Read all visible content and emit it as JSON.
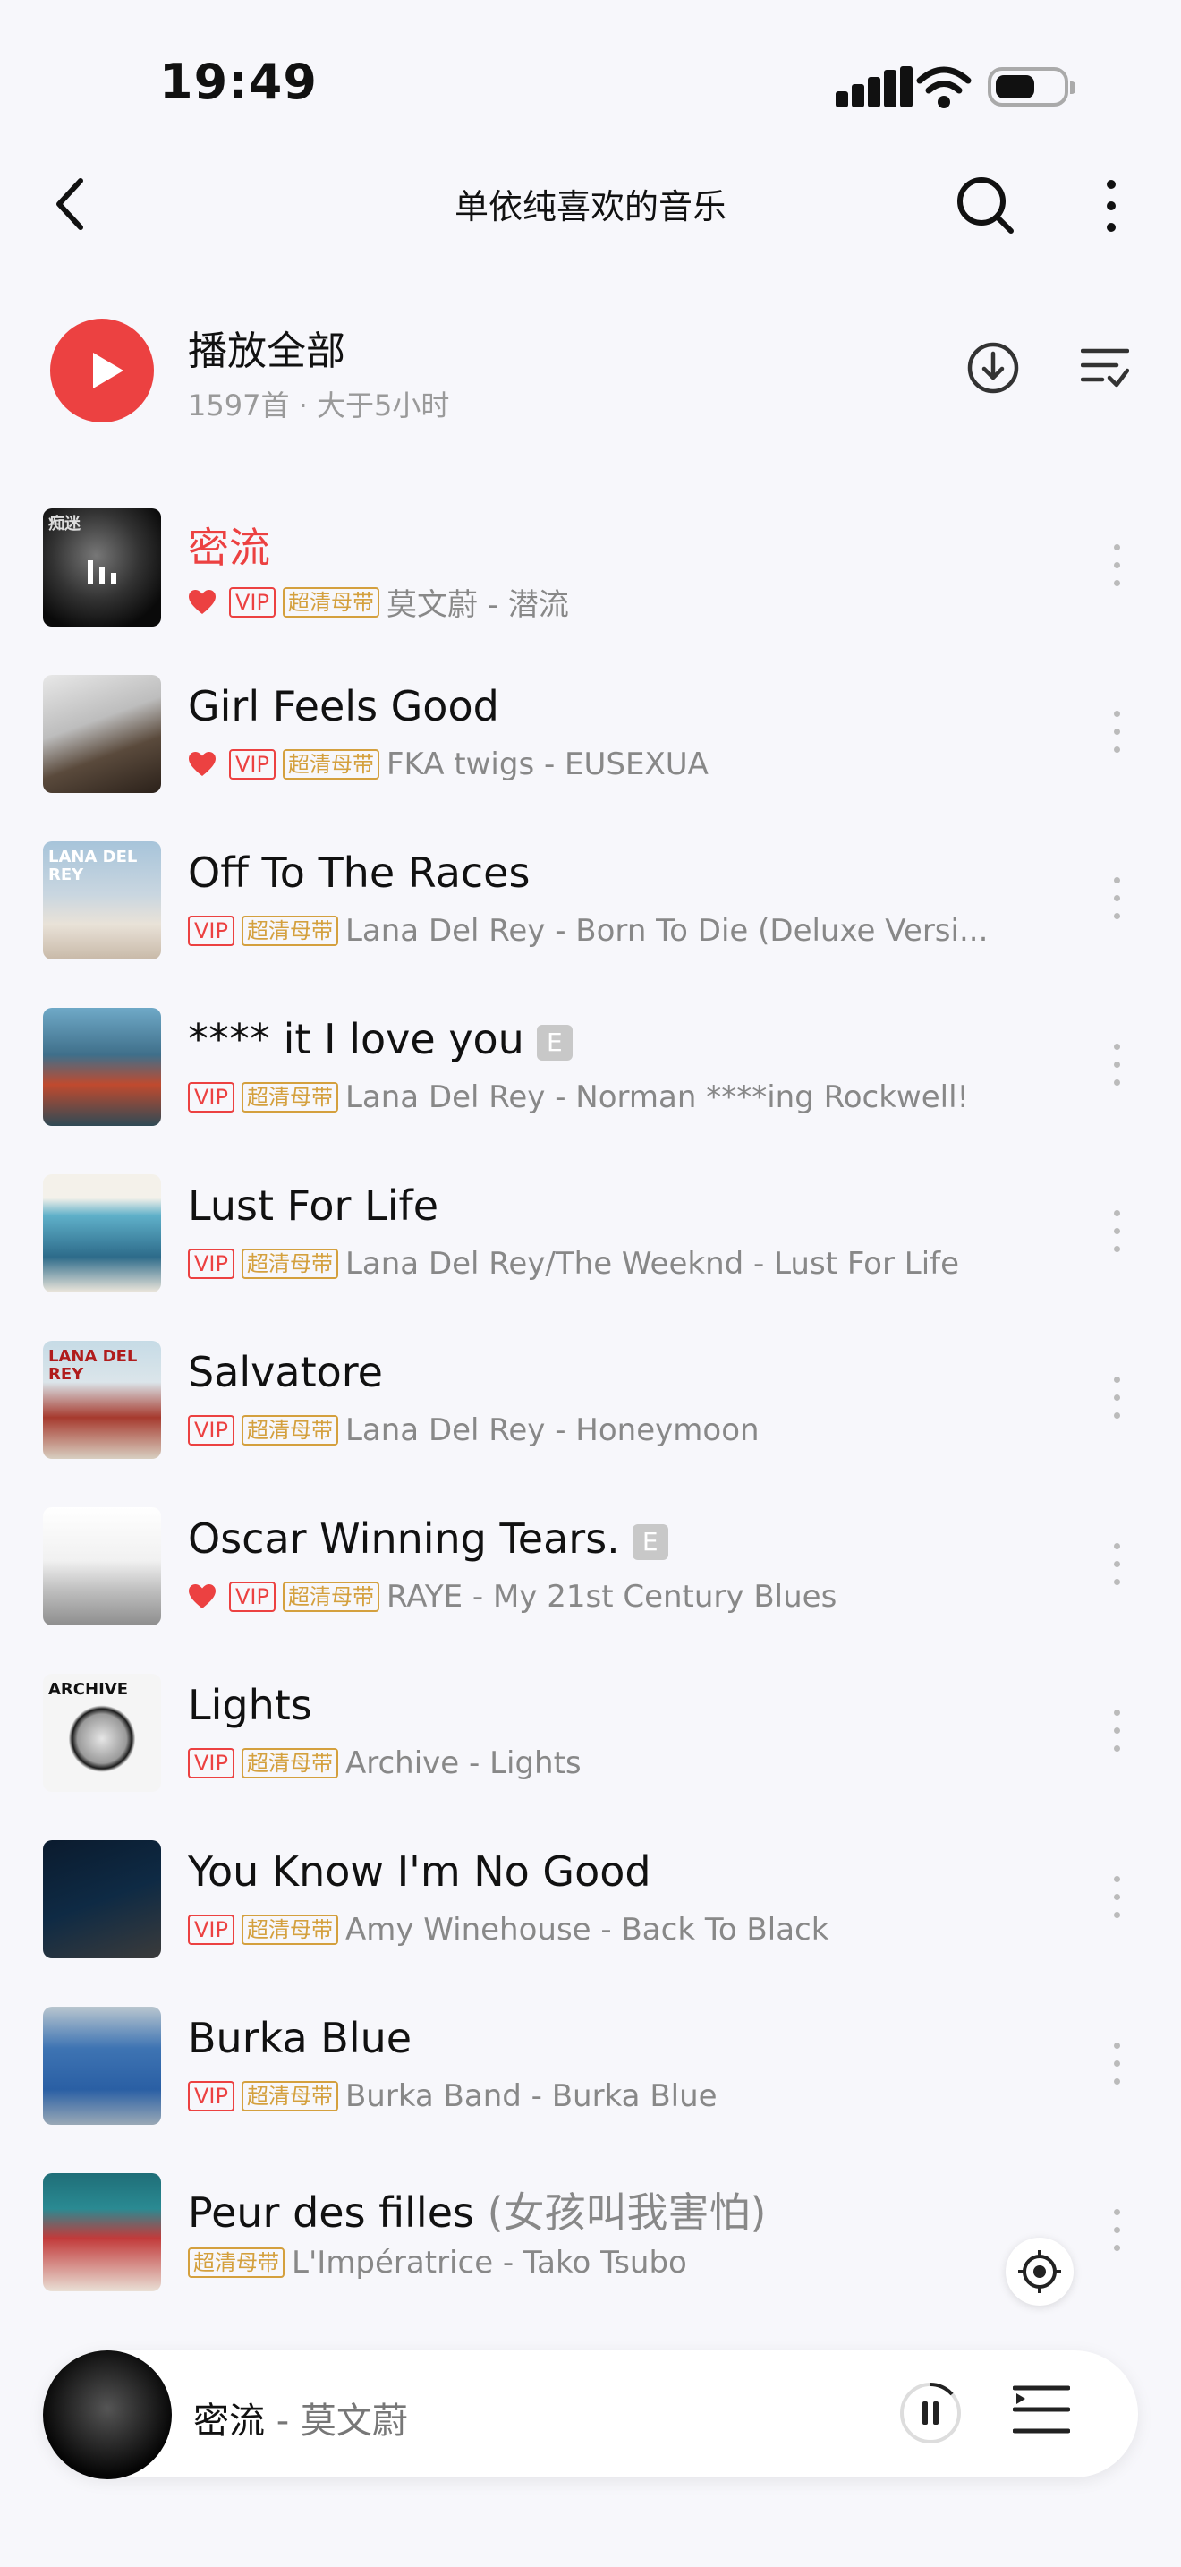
{
  "status": {
    "time": "19:49"
  },
  "nav": {
    "title": "单依纯喜欢的音乐"
  },
  "play_all": {
    "label": "播放全部",
    "count": "1597首 · 大于5小时"
  },
  "badges": {
    "vip": "VIP",
    "hq": "超清母带",
    "explicit": "E"
  },
  "covers": {
    "c0": "痴迷",
    "c2": "LANA DEL REY",
    "c5": "LANA DEL REY",
    "c7": "ARCHIVE"
  },
  "songs": [
    {
      "title": "密流",
      "meta": "莫文蔚 - 潜流",
      "playing": true,
      "liked": true,
      "vip": true,
      "hq": true,
      "explicit": false
    },
    {
      "title": "Girl Feels Good",
      "meta": "FKA twigs - EUSEXUA",
      "liked": true,
      "vip": true,
      "hq": true,
      "explicit": false
    },
    {
      "title": "Off To The Races",
      "meta": "Lana Del Rey - Born To Die (Deluxe Versi...",
      "liked": false,
      "vip": true,
      "hq": true,
      "explicit": false
    },
    {
      "title": "**** it I love you",
      "meta": "Lana Del Rey - Norman ****ing Rockwell!",
      "liked": false,
      "vip": true,
      "hq": true,
      "explicit": true
    },
    {
      "title": "Lust For Life",
      "meta": "Lana Del Rey/The Weeknd - Lust For Life",
      "liked": false,
      "vip": true,
      "hq": true,
      "explicit": false
    },
    {
      "title": "Salvatore",
      "meta": "Lana Del Rey - Honeymoon",
      "liked": false,
      "vip": true,
      "hq": true,
      "explicit": false
    },
    {
      "title": "Oscar Winning Tears.",
      "meta": "RAYE - My 21st Century Blues",
      "liked": true,
      "vip": true,
      "hq": true,
      "explicit": true
    },
    {
      "title": "Lights",
      "meta": "Archive - Lights",
      "liked": false,
      "vip": true,
      "hq": true,
      "explicit": false
    },
    {
      "title": "You Know I'm No Good",
      "meta": "Amy Winehouse - Back To Black",
      "liked": false,
      "vip": true,
      "hq": true,
      "explicit": false
    },
    {
      "title": "Burka Blue",
      "meta": "Burka Band - Burka Blue",
      "liked": false,
      "vip": true,
      "hq": true,
      "explicit": false
    },
    {
      "title": "Peur des filles",
      "subtitle": "(女孩叫我害怕)",
      "meta": "L'Impératrice - Tako Tsubo",
      "liked": false,
      "vip": false,
      "hq": true,
      "explicit": false
    }
  ],
  "mini_player": {
    "title": "密流",
    "artist": " - 莫文蔚"
  },
  "colors": {
    "accent": "#ec4141",
    "hq": "#d4a03e",
    "bg": "#f7f7fb"
  },
  "icons": [
    "back-icon",
    "search-icon",
    "more-vertical-icon",
    "play-icon",
    "download-icon",
    "sort-icon",
    "heart-icon",
    "locate-icon",
    "pause-icon",
    "playlist-icon"
  ]
}
